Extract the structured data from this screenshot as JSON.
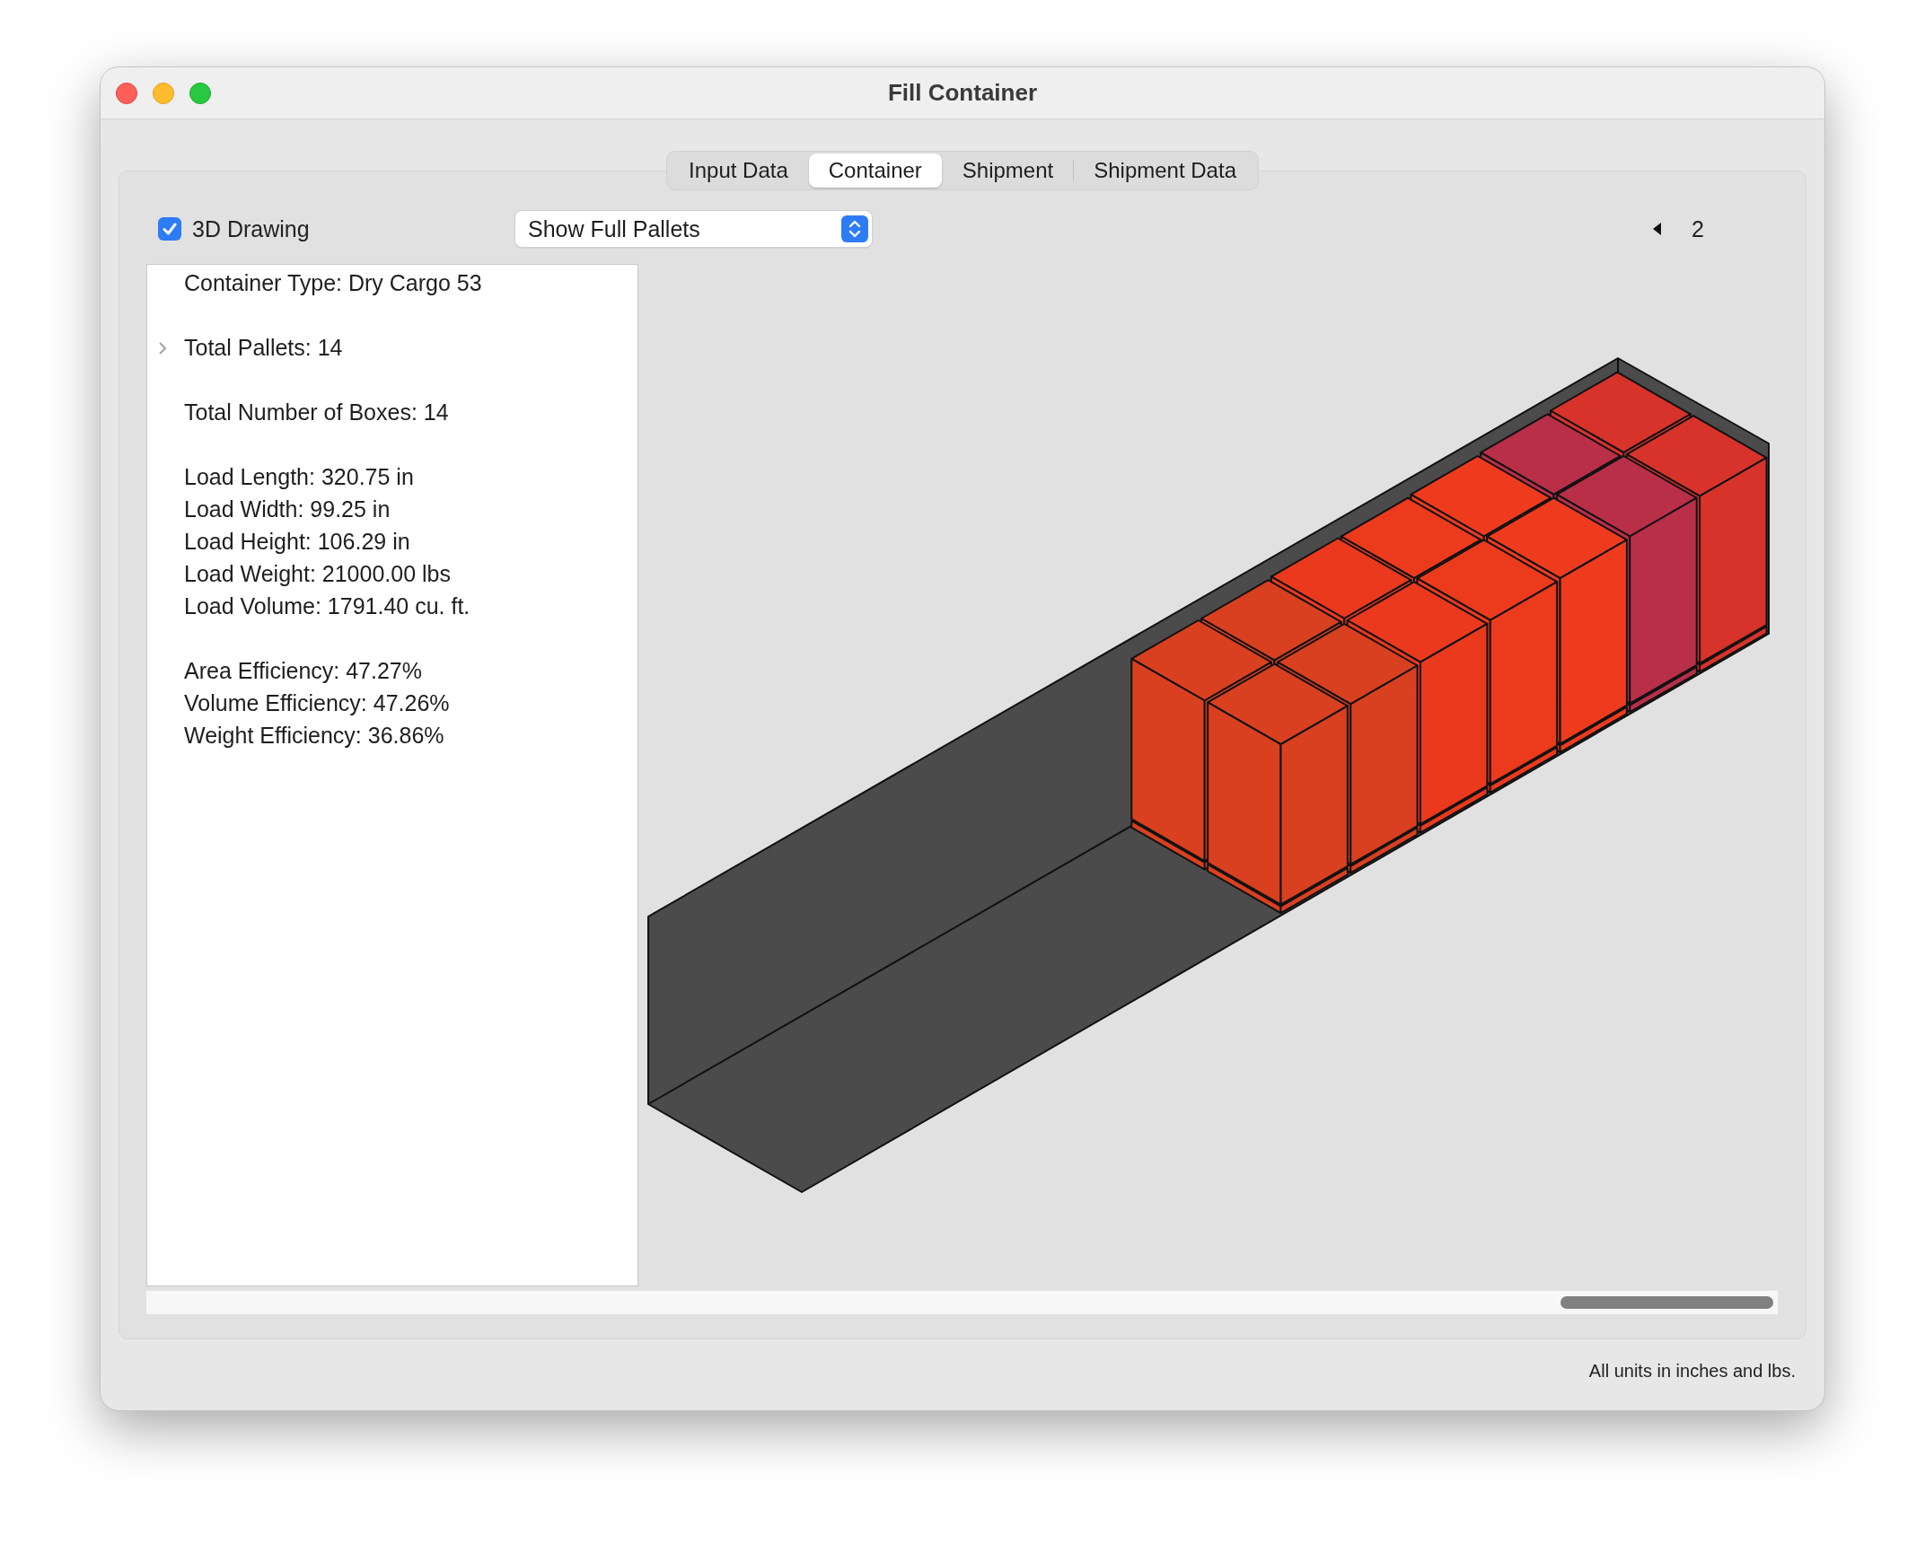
{
  "window": {
    "title": "Fill Container"
  },
  "tabs": [
    {
      "label": "Input Data",
      "selected": false
    },
    {
      "label": "Container",
      "selected": true
    },
    {
      "label": "Shipment",
      "selected": false
    },
    {
      "label": "Shipment Data",
      "selected": false
    }
  ],
  "toolbar": {
    "drawing_3d": {
      "label": "3D Drawing",
      "checked": true
    },
    "view_popup": {
      "value": "Show Full Pallets"
    },
    "pager": {
      "page": "2"
    }
  },
  "summary": {
    "sections": [
      [
        {
          "kind": "row",
          "text": "Container Type: Dry Cargo 53"
        }
      ],
      [
        {
          "kind": "disclosure",
          "text": "Total Pallets: 14",
          "expanded": false
        }
      ],
      [
        {
          "kind": "row",
          "text": "Total Number of Boxes: 14"
        }
      ],
      [
        {
          "kind": "row",
          "text": "Load Length: 320.75 in"
        },
        {
          "kind": "row",
          "text": "Load Width: 99.25 in"
        },
        {
          "kind": "row",
          "text": "Load Height: 106.29 in"
        },
        {
          "kind": "row",
          "text": "Load Weight: 21000.00 lbs"
        },
        {
          "kind": "row",
          "text": "Load Volume: 1791.40 cu. ft."
        }
      ],
      [
        {
          "kind": "row",
          "text": "Area Efficiency: 47.27%"
        },
        {
          "kind": "row",
          "text": "Volume Efficiency: 47.26%"
        },
        {
          "kind": "row",
          "text": "Weight Efficiency: 36.86%"
        }
      ]
    ]
  },
  "footer": {
    "note": "All units in inches and lbs."
  }
}
